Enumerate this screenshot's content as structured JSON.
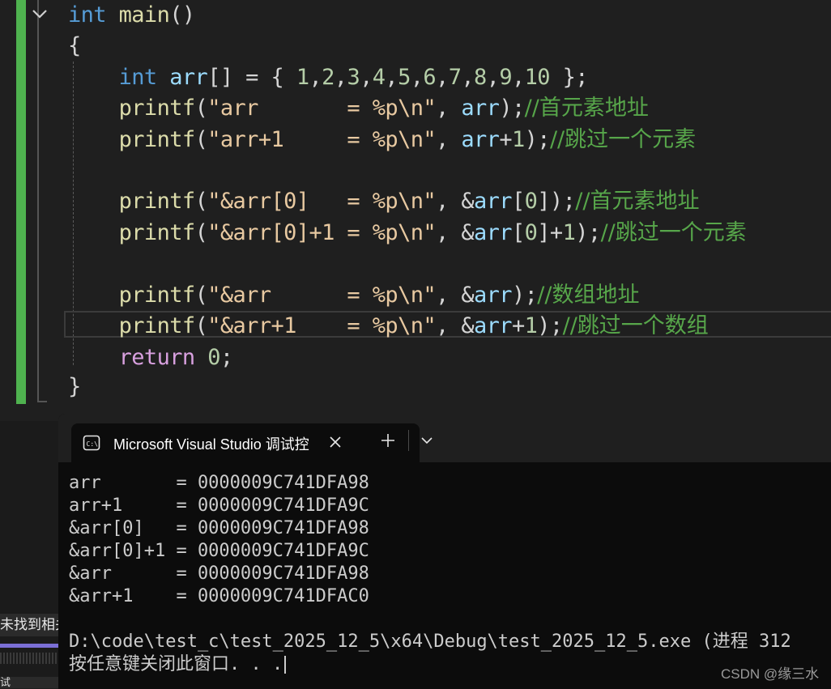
{
  "editor": {
    "lines": [
      {
        "tokens": [
          {
            "t": "int",
            "c": "kw"
          },
          {
            "t": " ",
            "c": "pl"
          },
          {
            "t": "main",
            "c": "fn"
          },
          {
            "t": "()",
            "c": "pl"
          }
        ]
      },
      {
        "tokens": [
          {
            "t": "{",
            "c": "pl"
          }
        ]
      },
      {
        "tokens": []
      },
      {
        "tokens": [
          {
            "t": "    ",
            "c": "pl"
          },
          {
            "t": "int",
            "c": "kw"
          },
          {
            "t": " ",
            "c": "pl"
          },
          {
            "t": "arr",
            "c": "var"
          },
          {
            "t": "[] = { ",
            "c": "pl"
          },
          {
            "t": "1",
            "c": "num"
          },
          {
            "t": ",",
            "c": "pl"
          },
          {
            "t": "2",
            "c": "num"
          },
          {
            "t": ",",
            "c": "pl"
          },
          {
            "t": "3",
            "c": "num"
          },
          {
            "t": ",",
            "c": "pl"
          },
          {
            "t": "4",
            "c": "num"
          },
          {
            "t": ",",
            "c": "pl"
          },
          {
            "t": "5",
            "c": "num"
          },
          {
            "t": ",",
            "c": "pl"
          },
          {
            "t": "6",
            "c": "num"
          },
          {
            "t": ",",
            "c": "pl"
          },
          {
            "t": "7",
            "c": "num"
          },
          {
            "t": ",",
            "c": "pl"
          },
          {
            "t": "8",
            "c": "num"
          },
          {
            "t": ",",
            "c": "pl"
          },
          {
            "t": "9",
            "c": "num"
          },
          {
            "t": ",",
            "c": "pl"
          },
          {
            "t": "10",
            "c": "num"
          },
          {
            "t": " };",
            "c": "pl"
          }
        ]
      },
      {
        "tokens": [
          {
            "t": "    ",
            "c": "pl"
          },
          {
            "t": "printf",
            "c": "fn"
          },
          {
            "t": "(",
            "c": "pl"
          },
          {
            "t": "\"arr       = %p",
            "c": "str"
          },
          {
            "t": "\\n",
            "c": "esc"
          },
          {
            "t": "\"",
            "c": "str"
          },
          {
            "t": ", ",
            "c": "pl"
          },
          {
            "t": "arr",
            "c": "var"
          },
          {
            "t": ");",
            "c": "pl"
          },
          {
            "t": "//首元素地址",
            "c": "cm"
          }
        ]
      },
      {
        "tokens": [
          {
            "t": "    ",
            "c": "pl"
          },
          {
            "t": "printf",
            "c": "fn"
          },
          {
            "t": "(",
            "c": "pl"
          },
          {
            "t": "\"arr+1     = %p",
            "c": "str"
          },
          {
            "t": "\\n",
            "c": "esc"
          },
          {
            "t": "\"",
            "c": "str"
          },
          {
            "t": ", ",
            "c": "pl"
          },
          {
            "t": "arr",
            "c": "var"
          },
          {
            "t": "+",
            "c": "pl"
          },
          {
            "t": "1",
            "c": "num"
          },
          {
            "t": ");",
            "c": "pl"
          },
          {
            "t": "//跳过一个元素",
            "c": "cm"
          }
        ]
      },
      {
        "tokens": []
      },
      {
        "tokens": [
          {
            "t": "    ",
            "c": "pl"
          },
          {
            "t": "printf",
            "c": "fn"
          },
          {
            "t": "(",
            "c": "pl"
          },
          {
            "t": "\"&arr[0]   = %p",
            "c": "str"
          },
          {
            "t": "\\n",
            "c": "esc"
          },
          {
            "t": "\"",
            "c": "str"
          },
          {
            "t": ", &",
            "c": "pl"
          },
          {
            "t": "arr",
            "c": "var"
          },
          {
            "t": "[",
            "c": "pl"
          },
          {
            "t": "0",
            "c": "num"
          },
          {
            "t": "]);",
            "c": "pl"
          },
          {
            "t": "//首元素地址",
            "c": "cm"
          }
        ]
      },
      {
        "tokens": [
          {
            "t": "    ",
            "c": "pl"
          },
          {
            "t": "printf",
            "c": "fn"
          },
          {
            "t": "(",
            "c": "pl"
          },
          {
            "t": "\"&arr[0]+1 = %p",
            "c": "str"
          },
          {
            "t": "\\n",
            "c": "esc"
          },
          {
            "t": "\"",
            "c": "str"
          },
          {
            "t": ", &",
            "c": "pl"
          },
          {
            "t": "arr",
            "c": "var"
          },
          {
            "t": "[",
            "c": "pl"
          },
          {
            "t": "0",
            "c": "num"
          },
          {
            "t": "]+",
            "c": "pl"
          },
          {
            "t": "1",
            "c": "num"
          },
          {
            "t": ");",
            "c": "pl"
          },
          {
            "t": "//跳过一个元素",
            "c": "cm"
          }
        ]
      },
      {
        "tokens": []
      },
      {
        "tokens": [
          {
            "t": "    ",
            "c": "pl"
          },
          {
            "t": "printf",
            "c": "fn"
          },
          {
            "t": "(",
            "c": "pl"
          },
          {
            "t": "\"&arr      = %p",
            "c": "str"
          },
          {
            "t": "\\n",
            "c": "esc"
          },
          {
            "t": "\"",
            "c": "str"
          },
          {
            "t": ", &",
            "c": "pl"
          },
          {
            "t": "arr",
            "c": "var"
          },
          {
            "t": ");",
            "c": "pl"
          },
          {
            "t": "//数组地址",
            "c": "cm"
          }
        ]
      },
      {
        "tokens": [
          {
            "t": "    ",
            "c": "pl"
          },
          {
            "t": "printf",
            "c": "fn"
          },
          {
            "t": "(",
            "c": "pl"
          },
          {
            "t": "\"&arr+1    = %p",
            "c": "str"
          },
          {
            "t": "\\n",
            "c": "esc"
          },
          {
            "t": "\"",
            "c": "str"
          },
          {
            "t": ", &",
            "c": "pl"
          },
          {
            "t": "arr",
            "c": "var"
          },
          {
            "t": "+",
            "c": "pl"
          },
          {
            "t": "1",
            "c": "num"
          },
          {
            "t": ");",
            "c": "pl"
          },
          {
            "t": "//跳过一个数组",
            "c": "cm"
          }
        ]
      },
      {
        "tokens": [
          {
            "t": "    ",
            "c": "pl"
          },
          {
            "t": "return",
            "c": "kw2"
          },
          {
            "t": " ",
            "c": "pl"
          },
          {
            "t": "0",
            "c": "num"
          },
          {
            "t": ";",
            "c": "pl"
          }
        ]
      },
      {
        "tokens": [
          {
            "t": "}",
            "c": "pl"
          }
        ]
      }
    ]
  },
  "left_panel": {
    "search_text": "未找到相关",
    "bottom_text": "试"
  },
  "terminal": {
    "tab_title": "Microsoft Visual Studio 调试控",
    "tab_icon": "console-icon",
    "close_icon": "close-icon",
    "add_tab_icon": "plus-icon",
    "dropdown_icon": "chevron-down-icon",
    "output_lines": [
      "arr       = 0000009C741DFA98",
      "arr+1     = 0000009C741DFA9C",
      "&arr[0]   = 0000009C741DFA98",
      "&arr[0]+1 = 0000009C741DFA9C",
      "&arr      = 0000009C741DFA98",
      "&arr+1    = 0000009C741DFAC0",
      "",
      "D:\\code\\test_c\\test_2025_12_5\\x64\\Debug\\test_2025_12_5.exe (进程 312",
      "按任意键关闭此窗口. . ."
    ]
  },
  "watermark": "CSDN @缘三水"
}
